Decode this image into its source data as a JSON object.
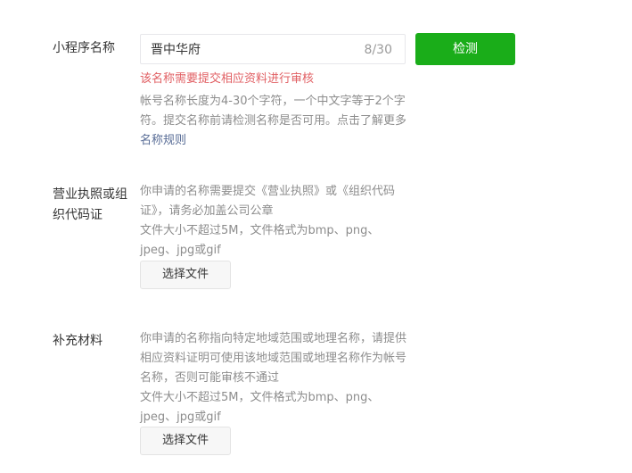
{
  "name_row": {
    "label": "小程序名称",
    "input_value": "晋中华府",
    "counter": "8/30",
    "check_button": "检测",
    "error": "该名称需要提交相应资料进行审核",
    "tip_text": "帐号名称长度为4-30个字符，一个中文字等于2个字符。提交名称前请检测名称是否可用。点击了解更多",
    "tip_link": "名称规则"
  },
  "license_row": {
    "label": "营业执照或组织代码证",
    "tip_line1": "你申请的名称需要提交《营业执照》或《组织代码证》，请务必加盖公司公章",
    "tip_line2": "文件大小不超过5M，文件格式为bmp、png、jpeg、jpg或gif",
    "file_button": "选择文件"
  },
  "extra_row": {
    "label": "补充材料",
    "tip_line1": "你申请的名称指向特定地域范围或地理名称，请提供相应资料证明可使用该地域范围或地理名称作为帐号名称，否则可能审核不通过",
    "tip_line2": "文件大小不超过5M，文件格式为bmp、png、jpeg、jpg或gif",
    "file_button": "选择文件"
  },
  "colors": {
    "primary_green": "#1aad19",
    "error_red": "#e15f63",
    "link_blue": "#576b95"
  }
}
